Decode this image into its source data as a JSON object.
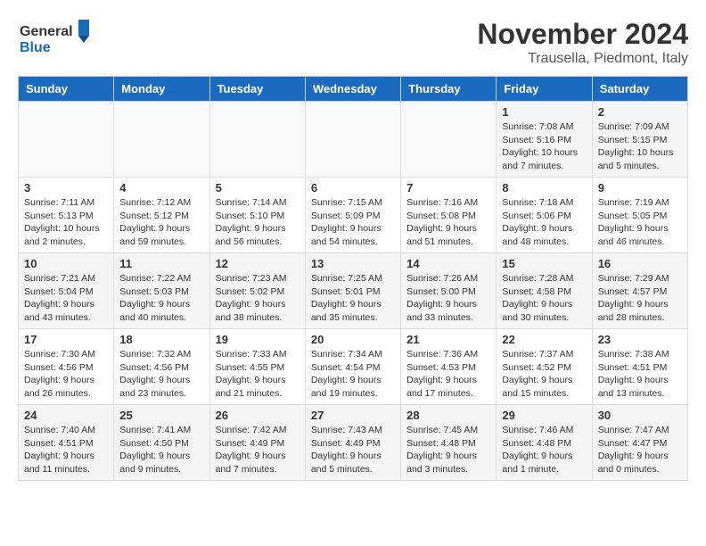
{
  "header": {
    "logo_general": "General",
    "logo_blue": "Blue",
    "title": "November 2024",
    "location": "Trausella, Piedmont, Italy"
  },
  "weekdays": [
    "Sunday",
    "Monday",
    "Tuesday",
    "Wednesday",
    "Thursday",
    "Friday",
    "Saturday"
  ],
  "weeks": [
    [
      {
        "day": "",
        "info": ""
      },
      {
        "day": "",
        "info": ""
      },
      {
        "day": "",
        "info": ""
      },
      {
        "day": "",
        "info": ""
      },
      {
        "day": "",
        "info": ""
      },
      {
        "day": "1",
        "info": "Sunrise: 7:08 AM\nSunset: 5:16 PM\nDaylight: 10 hours and 7 minutes."
      },
      {
        "day": "2",
        "info": "Sunrise: 7:09 AM\nSunset: 5:15 PM\nDaylight: 10 hours and 5 minutes."
      }
    ],
    [
      {
        "day": "3",
        "info": "Sunrise: 7:11 AM\nSunset: 5:13 PM\nDaylight: 10 hours and 2 minutes."
      },
      {
        "day": "4",
        "info": "Sunrise: 7:12 AM\nSunset: 5:12 PM\nDaylight: 9 hours and 59 minutes."
      },
      {
        "day": "5",
        "info": "Sunrise: 7:14 AM\nSunset: 5:10 PM\nDaylight: 9 hours and 56 minutes."
      },
      {
        "day": "6",
        "info": "Sunrise: 7:15 AM\nSunset: 5:09 PM\nDaylight: 9 hours and 54 minutes."
      },
      {
        "day": "7",
        "info": "Sunrise: 7:16 AM\nSunset: 5:08 PM\nDaylight: 9 hours and 51 minutes."
      },
      {
        "day": "8",
        "info": "Sunrise: 7:18 AM\nSunset: 5:06 PM\nDaylight: 9 hours and 48 minutes."
      },
      {
        "day": "9",
        "info": "Sunrise: 7:19 AM\nSunset: 5:05 PM\nDaylight: 9 hours and 46 minutes."
      }
    ],
    [
      {
        "day": "10",
        "info": "Sunrise: 7:21 AM\nSunset: 5:04 PM\nDaylight: 9 hours and 43 minutes."
      },
      {
        "day": "11",
        "info": "Sunrise: 7:22 AM\nSunset: 5:03 PM\nDaylight: 9 hours and 40 minutes."
      },
      {
        "day": "12",
        "info": "Sunrise: 7:23 AM\nSunset: 5:02 PM\nDaylight: 9 hours and 38 minutes."
      },
      {
        "day": "13",
        "info": "Sunrise: 7:25 AM\nSunset: 5:01 PM\nDaylight: 9 hours and 35 minutes."
      },
      {
        "day": "14",
        "info": "Sunrise: 7:26 AM\nSunset: 5:00 PM\nDaylight: 9 hours and 33 minutes."
      },
      {
        "day": "15",
        "info": "Sunrise: 7:28 AM\nSunset: 4:58 PM\nDaylight: 9 hours and 30 minutes."
      },
      {
        "day": "16",
        "info": "Sunrise: 7:29 AM\nSunset: 4:57 PM\nDaylight: 9 hours and 28 minutes."
      }
    ],
    [
      {
        "day": "17",
        "info": "Sunrise: 7:30 AM\nSunset: 4:56 PM\nDaylight: 9 hours and 26 minutes."
      },
      {
        "day": "18",
        "info": "Sunrise: 7:32 AM\nSunset: 4:56 PM\nDaylight: 9 hours and 23 minutes."
      },
      {
        "day": "19",
        "info": "Sunrise: 7:33 AM\nSunset: 4:55 PM\nDaylight: 9 hours and 21 minutes."
      },
      {
        "day": "20",
        "info": "Sunrise: 7:34 AM\nSunset: 4:54 PM\nDaylight: 9 hours and 19 minutes."
      },
      {
        "day": "21",
        "info": "Sunrise: 7:36 AM\nSunset: 4:53 PM\nDaylight: 9 hours and 17 minutes."
      },
      {
        "day": "22",
        "info": "Sunrise: 7:37 AM\nSunset: 4:52 PM\nDaylight: 9 hours and 15 minutes."
      },
      {
        "day": "23",
        "info": "Sunrise: 7:38 AM\nSunset: 4:51 PM\nDaylight: 9 hours and 13 minutes."
      }
    ],
    [
      {
        "day": "24",
        "info": "Sunrise: 7:40 AM\nSunset: 4:51 PM\nDaylight: 9 hours and 11 minutes."
      },
      {
        "day": "25",
        "info": "Sunrise: 7:41 AM\nSunset: 4:50 PM\nDaylight: 9 hours and 9 minutes."
      },
      {
        "day": "26",
        "info": "Sunrise: 7:42 AM\nSunset: 4:49 PM\nDaylight: 9 hours and 7 minutes."
      },
      {
        "day": "27",
        "info": "Sunrise: 7:43 AM\nSunset: 4:49 PM\nDaylight: 9 hours and 5 minutes."
      },
      {
        "day": "28",
        "info": "Sunrise: 7:45 AM\nSunset: 4:48 PM\nDaylight: 9 hours and 3 minutes."
      },
      {
        "day": "29",
        "info": "Sunrise: 7:46 AM\nSunset: 4:48 PM\nDaylight: 9 hours and 1 minute."
      },
      {
        "day": "30",
        "info": "Sunrise: 7:47 AM\nSunset: 4:47 PM\nDaylight: 9 hours and 0 minutes."
      }
    ]
  ]
}
